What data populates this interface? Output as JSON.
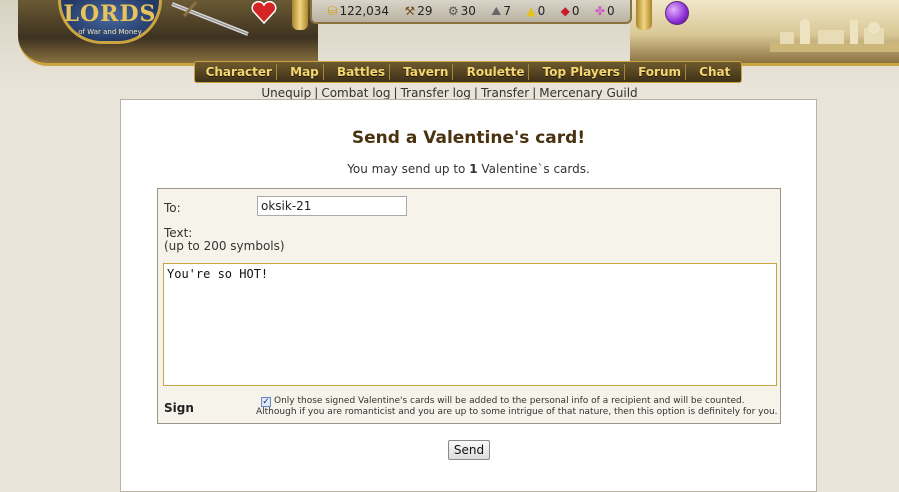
{
  "header": {
    "logo_title": "LORDS",
    "logo_subtitle": "of War and Money",
    "stats": [
      {
        "icon": "gold-coins-icon",
        "glyph": "⛁",
        "value": "122,034"
      },
      {
        "icon": "wood-icon",
        "glyph": "⚒",
        "value": "29"
      },
      {
        "icon": "iron-icon",
        "glyph": "⚙",
        "value": "30"
      },
      {
        "icon": "stone-icon",
        "glyph": "⛰",
        "value": "7"
      },
      {
        "icon": "sulfur-icon",
        "glyph": "▲",
        "value": "0"
      },
      {
        "icon": "gems-icon",
        "glyph": "◆",
        "value": "0"
      },
      {
        "icon": "crystals-icon",
        "glyph": "✤",
        "value": "0"
      }
    ]
  },
  "nav": {
    "items": [
      "Character",
      "Map",
      "Battles",
      "Tavern",
      "Roulette",
      "Top Players",
      "Forum",
      "Chat"
    ]
  },
  "subnav": {
    "items": [
      "Unequip",
      "Combat log",
      "Transfer log",
      "Transfer",
      "Mercenary Guild"
    ]
  },
  "page": {
    "title": "Send a Valentine's card!",
    "limit_prefix": "You may send up to ",
    "limit_count": "1",
    "limit_suffix": " Valentine`s cards."
  },
  "form": {
    "to_label": "To:",
    "to_value": "oksik-21",
    "text_label": "Text:",
    "text_hint": "(up to 200 symbols)",
    "text_value": "You're so HOT!",
    "sign_label": "Sign",
    "sign_checked": true,
    "sign_note_1": "Only those signed Valentine's cards will be added to the personal info of a recipient and will be counted.",
    "sign_note_2": "Although if you are romanticist and you are up to some intrigue of that nature, then this option is definitely for you.",
    "send_label": "Send"
  },
  "colors": {
    "accent_gold": "#c9a440",
    "nav_text": "#f4d770",
    "title_brown": "#4a3210",
    "heart_red": "#d42424",
    "orb_purple": "#8d2fd6"
  }
}
